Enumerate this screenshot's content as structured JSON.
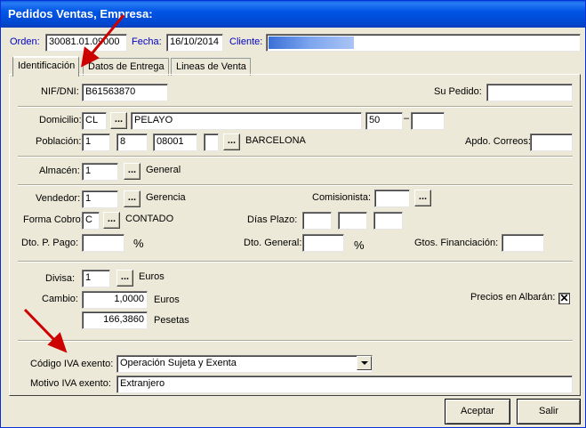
{
  "window": {
    "title": "Pedidos Ventas, Empresa:"
  },
  "header": {
    "orden_label": "Orden:",
    "orden_value": "30081.01.09000",
    "fecha_label": "Fecha:",
    "fecha_value": "16/10/2014",
    "cliente_label": "Cliente:"
  },
  "tabs": [
    {
      "label": "Identificación",
      "active": true
    },
    {
      "label": "Datos de Entrega",
      "active": false
    },
    {
      "label": "Lineas de Venta",
      "active": false
    }
  ],
  "identificacion": {
    "nif_label": "NIF/DNI:",
    "nif_value": "B61563870",
    "supedido_label": "Su Pedido:",
    "supedido_value": "",
    "domicilio_label": "Domicilio:",
    "domicilio_tipo": "CL",
    "domicilio_calle": "PELAYO",
    "domicilio_num": "50",
    "domicilio_dash": "–",
    "domicilio_extra": "",
    "poblacion_label": "Población:",
    "poblacion_1": "1",
    "poblacion_2": "8",
    "poblacion_cp": "08001",
    "poblacion_4": "",
    "poblacion_name": "BARCELONA",
    "apdo_label": "Apdo. Correos:",
    "apdo_value": "",
    "almacen_label": "Almacén:",
    "almacen_value": "1",
    "almacen_name": "General",
    "vendedor_label": "Vendedor:",
    "vendedor_value": "1",
    "vendedor_name": "Gerencia",
    "comisionista_label": "Comisionista:",
    "comisionista_value": "",
    "formacobro_label": "Forma Cobro:",
    "formacobro_value": "C",
    "formacobro_name": "CONTADO",
    "diasplazo_label": "Días Plazo:",
    "diasplazo_1": "",
    "diasplazo_2": "",
    "diasplazo_3": "",
    "dtopago_label": "Dto. P. Pago:",
    "dtopago_value": "",
    "dtopago_pct": "%",
    "dtogeneral_label": "Dto. General:",
    "dtogeneral_value": "",
    "dtogeneral_pct": "%",
    "gtos_label": "Gtos. Financiación:",
    "gtos_value": "",
    "divisa_label": "Divisa:",
    "divisa_value": "1",
    "divisa_name": "Euros",
    "cambio_label": "Cambio:",
    "cambio_value": "1,0000",
    "cambio_unit": "Euros",
    "pesetas_value": "166,3860",
    "pesetas_unit": "Pesetas",
    "precios_label": "Precios en Albarán:",
    "precios_checked": "✕",
    "codigoiva_label": "Código IVA exento:",
    "codigoiva_value": "Operación Sujeta y Exenta",
    "motivoiva_label": "Motivo IVA exento:",
    "motivoiva_value": "Extranjero",
    "dots": "..."
  },
  "buttons": {
    "aceptar": "Aceptar",
    "salir": "Salir"
  },
  "colors": {
    "arrow": "#cc0000",
    "titlebar": "#0055e5",
    "label_blue": "#0000c8"
  }
}
